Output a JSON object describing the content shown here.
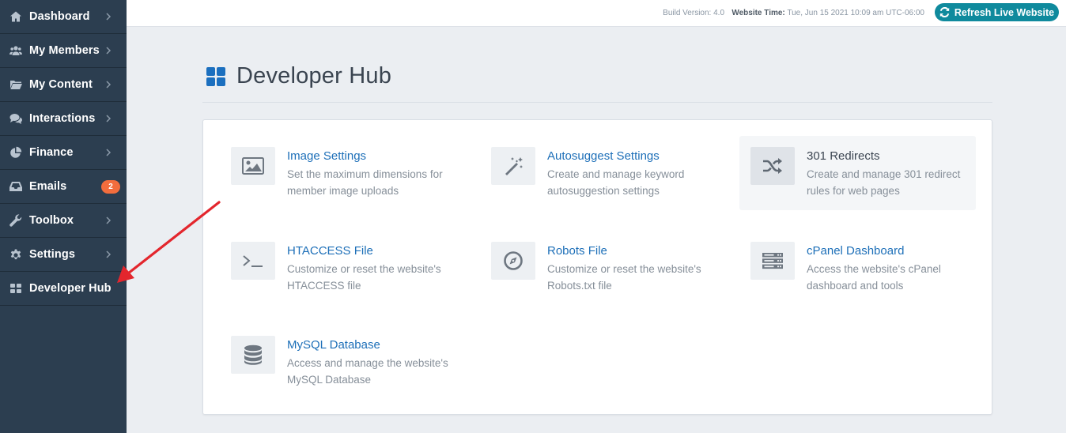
{
  "sidebar": {
    "items": [
      {
        "label": "Dashboard",
        "icon": "home-icon"
      },
      {
        "label": "My Members",
        "icon": "users-icon"
      },
      {
        "label": "My Content",
        "icon": "folder-icon"
      },
      {
        "label": "Interactions",
        "icon": "comments-icon"
      },
      {
        "label": "Finance",
        "icon": "pie-chart-icon"
      },
      {
        "label": "Emails",
        "icon": "inbox-icon",
        "badge": "2"
      },
      {
        "label": "Toolbox",
        "icon": "wrench-icon"
      },
      {
        "label": "Settings",
        "icon": "gear-icon"
      },
      {
        "label": "Developer Hub",
        "icon": "grid-icon"
      }
    ]
  },
  "topbar": {
    "build_label": "Build Version: 4.0",
    "time_label": "Website Time:",
    "time_value": "Tue, Jun 15 2021 10:09 am UTC-06:00",
    "refresh_label": "Refresh Live Website"
  },
  "page": {
    "title": "Developer Hub"
  },
  "tools": [
    {
      "name": "Image Settings",
      "desc": "Set the maximum dimensions for member image uploads",
      "icon": "image-icon"
    },
    {
      "name": "Autosuggest Settings",
      "desc": "Create and manage keyword autosuggestion settings",
      "icon": "magic-wand-icon"
    },
    {
      "name": "301 Redirects",
      "desc": "Create and manage 301 redirect rules for web pages",
      "icon": "shuffle-icon"
    },
    {
      "name": "HTACCESS File",
      "desc": "Customize or reset the website's HTACCESS file",
      "icon": "terminal-icon"
    },
    {
      "name": "Robots File",
      "desc": "Customize or reset the website's Robots.txt file",
      "icon": "compass-icon"
    },
    {
      "name": "cPanel Dashboard",
      "desc": "Access the website's cPanel dashboard and tools",
      "icon": "server-icon"
    },
    {
      "name": "MySQL Database",
      "desc": "Access and manage the website's MySQL Database",
      "icon": "database-icon"
    }
  ],
  "colors": {
    "sidebar_bg": "#2c3e50",
    "accent": "#1d6fb8",
    "refresh_bg": "#0f8a9d",
    "badge": "#f26d3d",
    "annotation_arrow": "#e3262d"
  }
}
